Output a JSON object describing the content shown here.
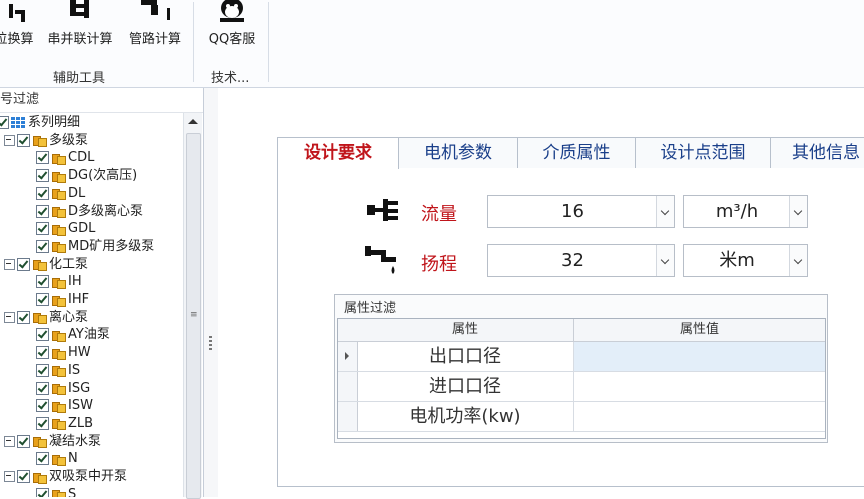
{
  "ribbon": {
    "buttons": [
      {
        "label": "位换算",
        "icon": "conversion-icon"
      },
      {
        "label": "串并联计算",
        "icon": "series-parallel-icon"
      },
      {
        "label": "管路计算",
        "icon": "pipe-icon"
      },
      {
        "label": "QQ客服",
        "icon": "qq-penguin-icon"
      }
    ],
    "groups": [
      {
        "label": "辅助工具"
      },
      {
        "label": "技术..."
      }
    ]
  },
  "left_panel": {
    "title": "号过滤",
    "tree": [
      {
        "label": "系列明细",
        "level": 0
      },
      {
        "label": "多级泵",
        "level": 1
      },
      {
        "label": "CDL",
        "level": 2
      },
      {
        "label": "DG(次高压)",
        "level": 2
      },
      {
        "label": "DL",
        "level": 2
      },
      {
        "label": "D多级离心泵",
        "level": 2
      },
      {
        "label": "GDL",
        "level": 2
      },
      {
        "label": "MD矿用多级泵",
        "level": 2
      },
      {
        "label": "化工泵",
        "level": 1
      },
      {
        "label": "IH",
        "level": 2
      },
      {
        "label": "IHF",
        "level": 2
      },
      {
        "label": "离心泵",
        "level": 1
      },
      {
        "label": "AY油泵",
        "level": 2
      },
      {
        "label": "HW",
        "level": 2
      },
      {
        "label": "IS",
        "level": 2
      },
      {
        "label": "ISG",
        "level": 2
      },
      {
        "label": "ISW",
        "level": 2
      },
      {
        "label": "ZLB",
        "level": 2
      },
      {
        "label": "凝结水泵",
        "level": 1
      },
      {
        "label": "N",
        "level": 2
      },
      {
        "label": "双吸泵中开泵",
        "level": 1
      },
      {
        "label": "S",
        "level": 2
      }
    ]
  },
  "tabs": [
    {
      "label": "设计要求",
      "active": true
    },
    {
      "label": "电机参数",
      "active": false
    },
    {
      "label": "介质属性",
      "active": false
    },
    {
      "label": "设计点范围",
      "active": false
    },
    {
      "label": "其他信息",
      "active": false
    }
  ],
  "design": {
    "flow": {
      "label": "流量",
      "value": "16",
      "unit": "m³/h",
      "icon": "flow-pipe-icon"
    },
    "head": {
      "label": "扬程",
      "value": "32",
      "unit": "米m",
      "icon": "faucet-icon"
    }
  },
  "filter": {
    "title": "属性过滤",
    "columns": [
      "属性",
      "属性值"
    ],
    "rows": [
      {
        "attr": "出口口径",
        "value": ""
      },
      {
        "attr": "进口口径",
        "value": ""
      },
      {
        "attr": "电机功率(kw)",
        "value": ""
      }
    ]
  },
  "colors": {
    "accent_red": "#c0151b",
    "tab_blue": "#1a3f8a"
  }
}
